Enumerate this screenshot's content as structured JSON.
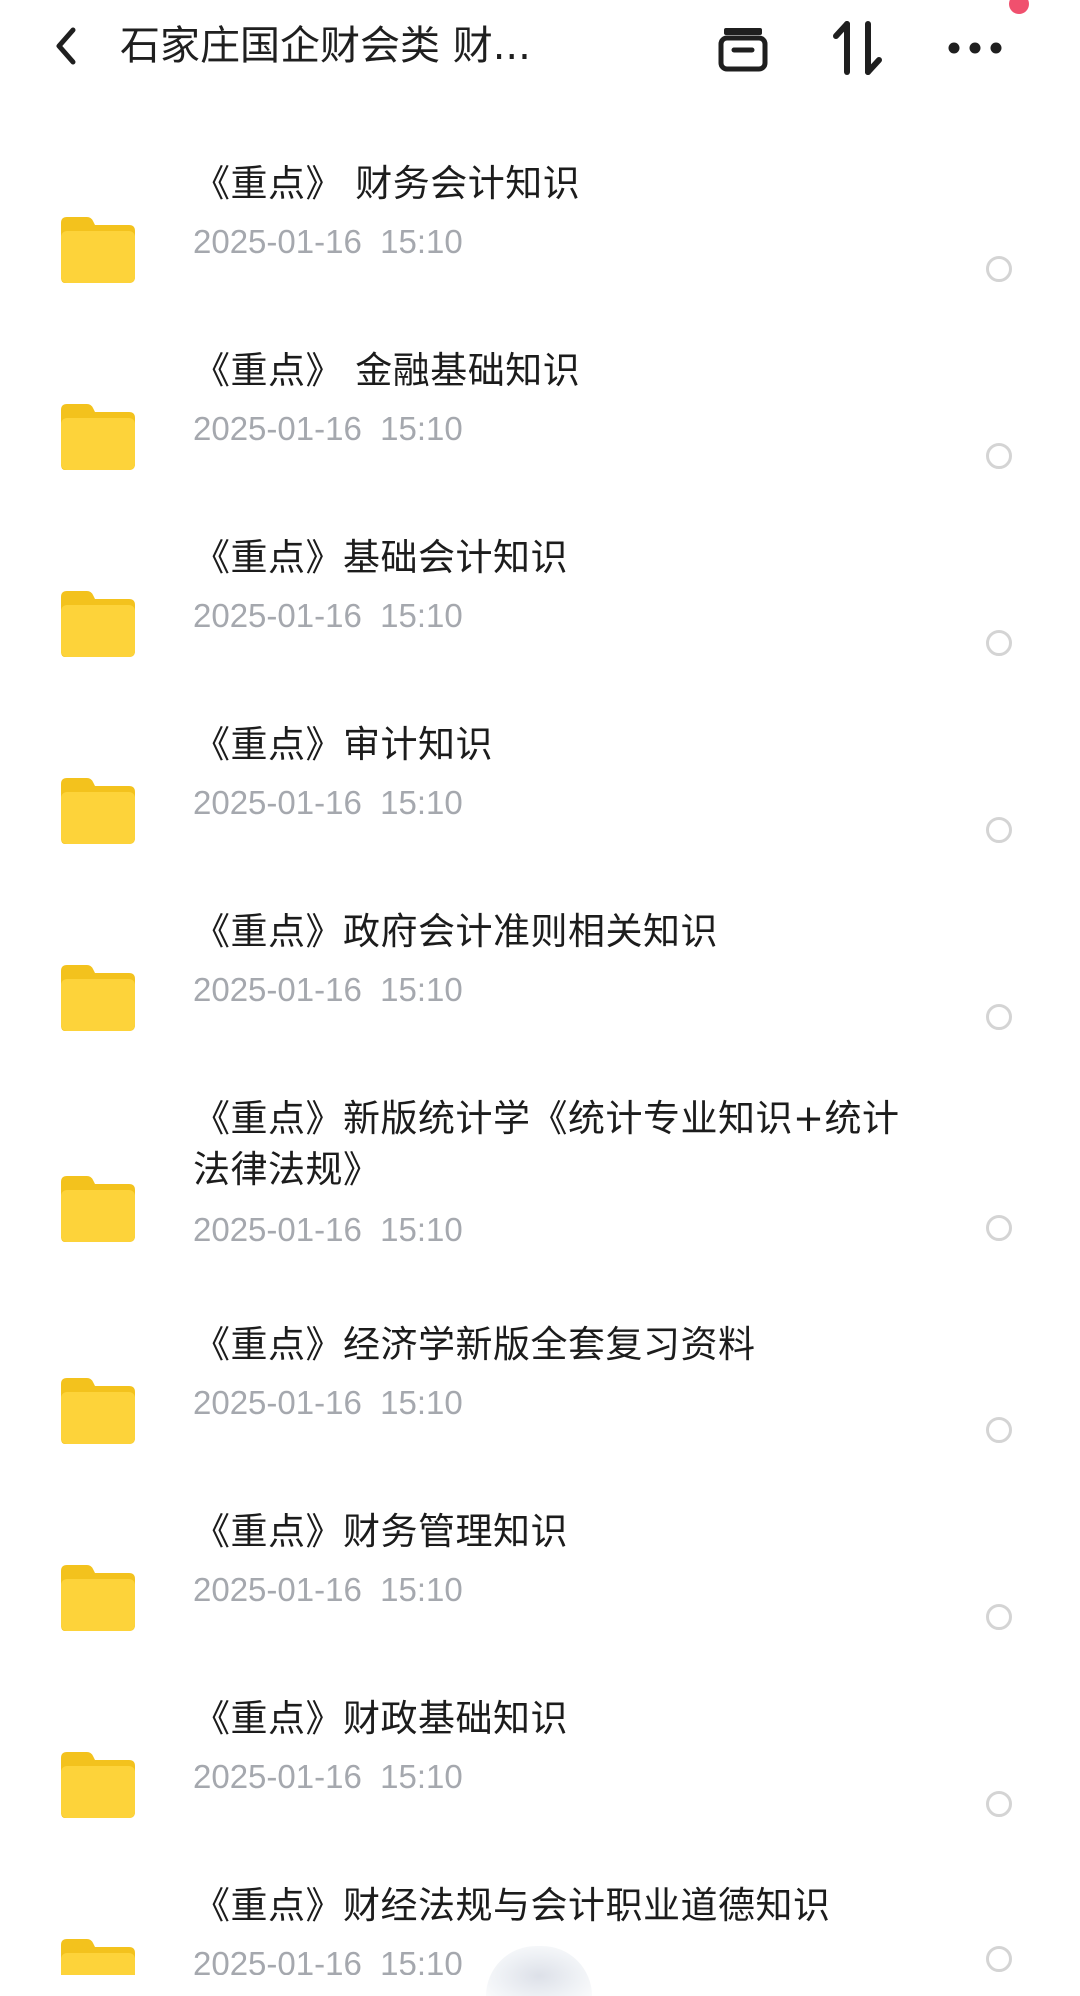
{
  "header": {
    "title": "石家庄国企财会类  财...",
    "back_icon": "chevron-left-icon",
    "archive_icon": "archive-box-icon",
    "sort_icon": "sort-arrows-icon",
    "more_icon": "more-dots-icon",
    "notify_color": "#f0506e"
  },
  "folder_color": "#fdd33a",
  "items": [
    {
      "name": "《重点》 财务会计知识",
      "date": "2025-01-16  15:10"
    },
    {
      "name": "《重点》 金融基础知识",
      "date": "2025-01-16  15:10"
    },
    {
      "name": "《重点》基础会计知识",
      "date": "2025-01-16  15:10"
    },
    {
      "name": "《重点》审计知识",
      "date": "2025-01-16  15:10"
    },
    {
      "name": "《重点》政府会计准则相关知识",
      "date": "2025-01-16  15:10"
    },
    {
      "name": "《重点》新版统计学《统计专业知识+统计法律法规》",
      "date": "2025-01-16  15:10"
    },
    {
      "name": "《重点》经济学新版全套复习资料",
      "date": "2025-01-16  15:10"
    },
    {
      "name": "《重点》财务管理知识",
      "date": "2025-01-16  15:10"
    },
    {
      "name": "《重点》财政基础知识",
      "date": "2025-01-16  15:10"
    },
    {
      "name": "《重点》财经法规与会计职业道德知识",
      "date": "2025-01-16  15:10"
    }
  ]
}
